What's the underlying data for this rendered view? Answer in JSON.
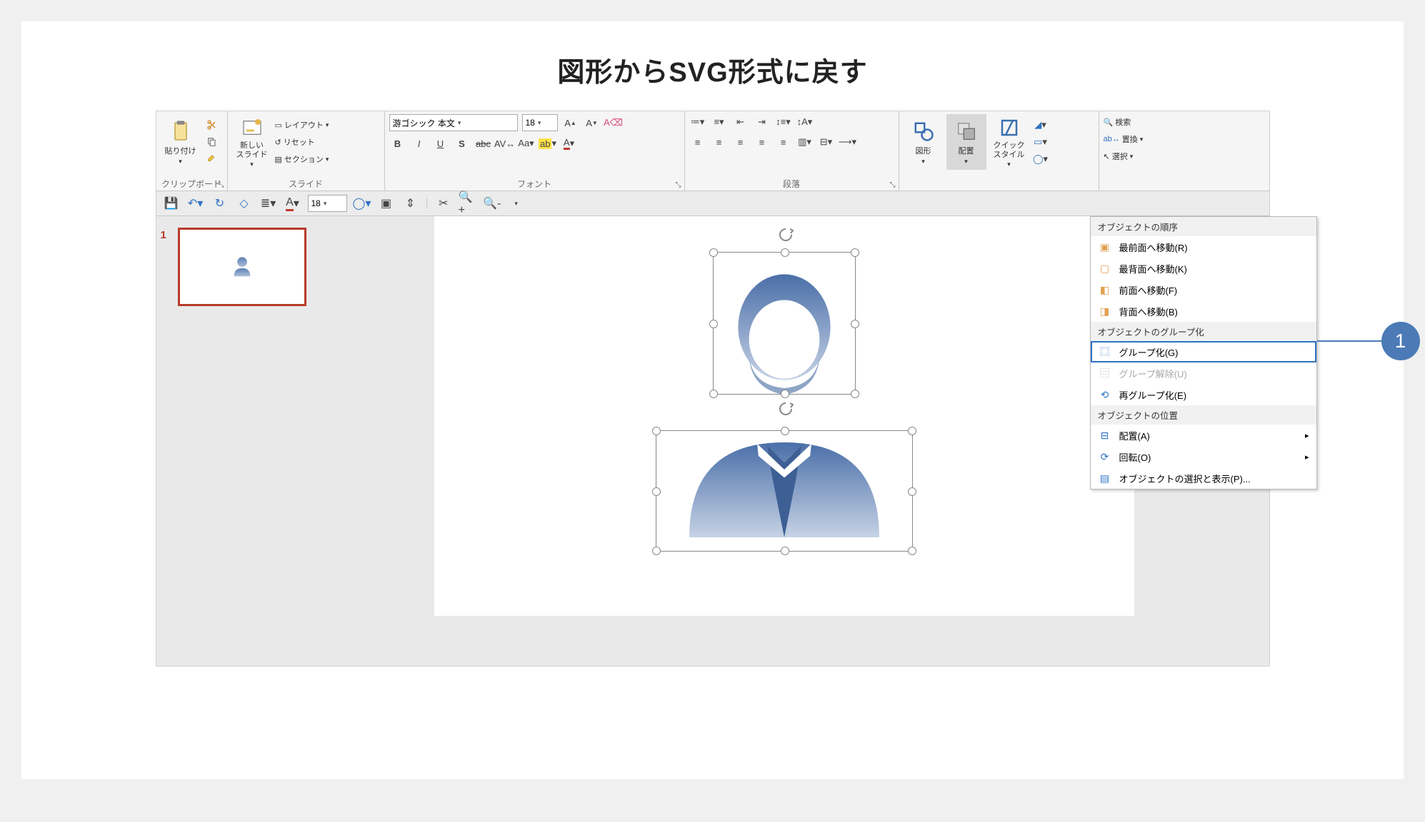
{
  "page_title": "図形からSVG形式に戻す",
  "callout_number": "1",
  "ribbon": {
    "clipboard": {
      "paste": "貼り付け",
      "label": "クリップボード"
    },
    "slides": {
      "new_slide": "新しい\nスライド",
      "layout": "レイアウト",
      "reset": "リセット",
      "section": "セクション",
      "label": "スライド"
    },
    "font": {
      "font_name": "游ゴシック 本文",
      "font_size": "18",
      "label": "フォント"
    },
    "paragraph": {
      "label": "段落"
    },
    "drawing": {
      "shapes": "図形",
      "arrange": "配置",
      "quick_style": "クイック\nスタイル"
    },
    "editing": {
      "find": "検索",
      "replace": "置換",
      "select": "選択"
    }
  },
  "qat_size": "18",
  "slide_number": "1",
  "context_menu": {
    "header_order": "オブジェクトの順序",
    "bring_front": "最前面へ移動(R)",
    "send_back": "最背面へ移動(K)",
    "bring_forward": "前面へ移動(F)",
    "send_backward": "背面へ移動(B)",
    "header_group": "オブジェクトのグループ化",
    "group": "グループ化(G)",
    "ungroup": "グループ解除(U)",
    "regroup": "再グループ化(E)",
    "header_position": "オブジェクトの位置",
    "align": "配置(A)",
    "rotate": "回転(O)",
    "selection_pane": "オブジェクトの選択と表示(P)..."
  }
}
